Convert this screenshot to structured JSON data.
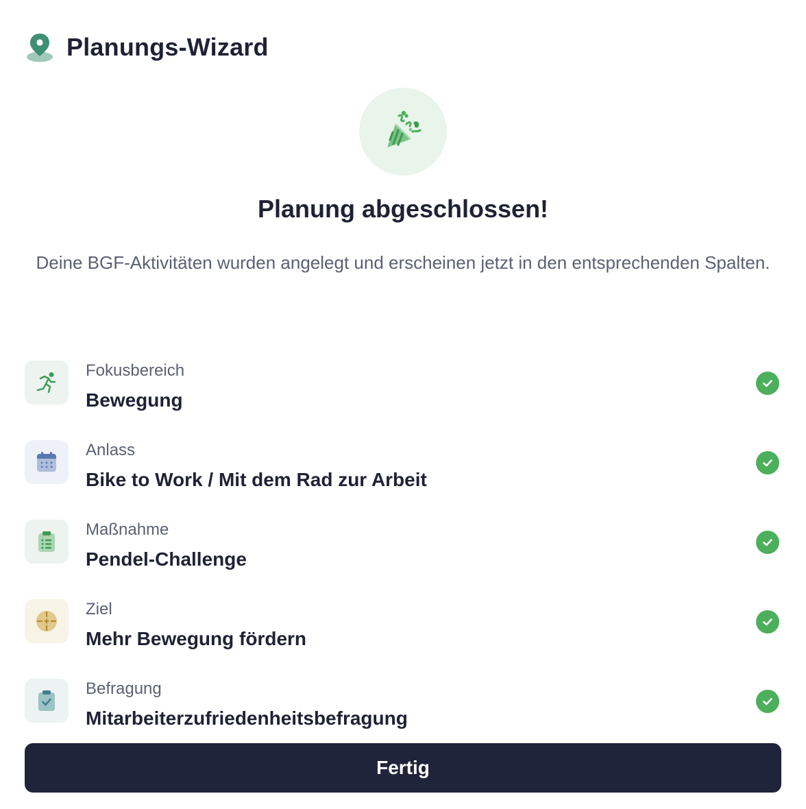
{
  "header": {
    "title": "Planungs-Wizard",
    "icon": "map-pin-icon"
  },
  "success": {
    "icon": "party-popper-icon",
    "title": "Planung abgeschlossen!",
    "description": "Deine BGF-Aktivitäten wurden angelegt und erscheinen jetzt in den entsprechenden Spalten."
  },
  "summary": {
    "items": [
      {
        "label": "Fokusbereich",
        "value": "Bewegung",
        "icon": "running-person-icon",
        "icon_bg": "#edf3ee"
      },
      {
        "label": "Anlass",
        "value": "Bike to Work / Mit dem Rad zur Arbeit",
        "icon": "calendar-icon",
        "icon_bg": "#eef1f7"
      },
      {
        "label": "Maßnahme",
        "value": "Pendel-Challenge",
        "icon": "clipboard-list-icon",
        "icon_bg": "#edf3ee"
      },
      {
        "label": "Ziel",
        "value": "Mehr Bewegung fördern",
        "icon": "target-icon",
        "icon_bg": "#f7f3e6"
      },
      {
        "label": "Befragung",
        "value": "Mitarbeiterzufriedenheitsbefragung",
        "icon": "clipboard-check-icon",
        "icon_bg": "#edf3f3"
      }
    ],
    "check_icon": "check-circle-icon",
    "check_color": "#4caf5b"
  },
  "actions": {
    "done_label": "Fertig",
    "done_color": "#20243a"
  },
  "colors": {
    "accent_green": "#4caf5b",
    "text_dark": "#1f2235",
    "text_muted": "#5b6072"
  }
}
